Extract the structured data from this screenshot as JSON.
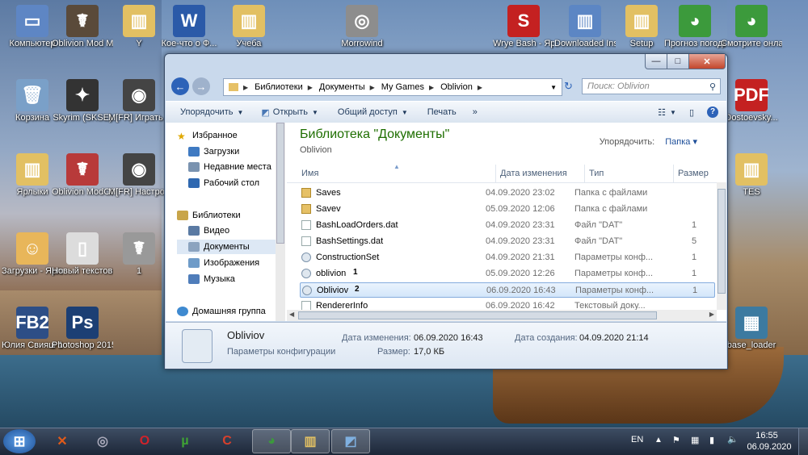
{
  "desktop": {
    "icons_left": [
      {
        "label": "Компьютер",
        "glyph": "▭",
        "color": "#5e86c4"
      },
      {
        "label": "Oblivion Mod M...",
        "glyph": "☤",
        "color": "#5a4a3a"
      },
      {
        "label": "Y",
        "glyph": "▥",
        "color": "#e2c063"
      },
      {
        "label": "Кое-что о Ф...",
        "glyph": "W",
        "color": "#2b5aa8"
      },
      {
        "label": "Учеба",
        "glyph": "▥",
        "color": "#e2c063"
      },
      {
        "label": "Morrowind",
        "glyph": "◎",
        "color": "#8d8d8d"
      },
      {
        "label": "Корзина",
        "glyph": "🗑",
        "color": "#7aa0c8"
      },
      {
        "label": "Skyrim (SKSE)",
        "glyph": "✦",
        "color": "#333"
      },
      {
        "label": "M[FR] Играть (...",
        "glyph": "◉",
        "color": "#444"
      },
      {
        "label": "Ярлыки",
        "glyph": "▥",
        "color": "#e2c063"
      },
      {
        "label": "Oblivion ModCORE",
        "glyph": "☤",
        "color": "#b83a3a"
      },
      {
        "label": "M[FR] Настройщик",
        "glyph": "◉",
        "color": "#444"
      },
      {
        "label": "Загрузки - Ярлык",
        "glyph": "☺",
        "color": "#e8b65a"
      },
      {
        "label": "Новый текстовый...",
        "glyph": "▯",
        "color": "#dcdcdc"
      },
      {
        "label": "1",
        "glyph": "☤",
        "color": "#999"
      },
      {
        "label": "Юлия Свияш 10 Запове...",
        "glyph": "FB2",
        "color": "#2d4e86"
      },
      {
        "label": "Photoshop 2015",
        "glyph": "Ps",
        "color": "#1c3f74"
      }
    ],
    "icons_right": [
      {
        "label": "Wrye Bash - Ярлык",
        "glyph": "S",
        "color": "#c42121"
      },
      {
        "label": "Downloaded Installers",
        "glyph": "▥",
        "color": "#5c86c4"
      },
      {
        "label": "Setup",
        "glyph": "▥",
        "color": "#e2c063"
      },
      {
        "label": "Прогноз погоды",
        "glyph": "◕",
        "color": "#3c9a3c"
      },
      {
        "label": "Смотрите онлайн пр...",
        "glyph": "◕",
        "color": "#3c9a3c"
      },
      {
        "label": "Dostoevsky...",
        "glyph": "PDF",
        "color": "#c42121"
      },
      {
        "label": "TES",
        "glyph": "▥",
        "color": "#e2c063"
      },
      {
        "label": "base_loader",
        "glyph": "▦",
        "color": "#3c7aa0"
      }
    ]
  },
  "window": {
    "controls": {
      "minimize": "—",
      "maximize": "□",
      "close": "✕"
    },
    "address": {
      "crumbs": [
        "Библиотеки",
        "Документы",
        "My Games",
        "Oblivion"
      ],
      "search_placeholder": "Поиск: Oblivion"
    },
    "toolbar": {
      "organize": "Упорядочить",
      "open": "Открыть",
      "share": "Общий доступ",
      "print": "Печать",
      "more": "»"
    },
    "nav": {
      "favorites": "Избранное",
      "downloads": "Загрузки",
      "recent": "Недавние места",
      "desktop": "Рабочий стол",
      "libraries": "Библиотеки",
      "video": "Видео",
      "documents": "Документы",
      "images": "Изображения",
      "music": "Музыка",
      "homegroup": "Домашняя группа"
    },
    "library": {
      "title": "Библиотека \"Документы\"",
      "subtitle": "Oblivion",
      "arrange_label": "Упорядочить:",
      "arrange_value": "Папка"
    },
    "columns": {
      "name": "Имя",
      "date": "Дата изменения",
      "type": "Тип",
      "size": "Размер"
    },
    "files": [
      {
        "name": "Saves",
        "date": "04.09.2020 23:02",
        "type": "Папка с файлами",
        "size": "",
        "kind": "folder",
        "mark": ""
      },
      {
        "name": "Savev",
        "date": "05.09.2020 12:06",
        "type": "Папка с файлами",
        "size": "",
        "kind": "folder",
        "mark": ""
      },
      {
        "name": "BashLoadOrders.dat",
        "date": "04.09.2020 23:31",
        "type": "Файл \"DAT\"",
        "size": "1",
        "kind": "file",
        "mark": ""
      },
      {
        "name": "BashSettings.dat",
        "date": "04.09.2020 23:31",
        "type": "Файл \"DAT\"",
        "size": "5",
        "kind": "file",
        "mark": ""
      },
      {
        "name": "ConstructionSet",
        "date": "04.09.2020 21:31",
        "type": "Параметры конф...",
        "size": "1",
        "kind": "cfg",
        "mark": ""
      },
      {
        "name": "oblivion",
        "date": "05.09.2020 12:26",
        "type": "Параметры конф...",
        "size": "1",
        "kind": "cfg",
        "mark": "1"
      },
      {
        "name": "Obliviov",
        "date": "06.09.2020 16:43",
        "type": "Параметры конф...",
        "size": "1",
        "kind": "cfg",
        "mark": "2"
      },
      {
        "name": "RendererInfo",
        "date": "06.09.2020 16:42",
        "type": "Текстовый доку...",
        "size": "",
        "kind": "file",
        "mark": ""
      }
    ],
    "details": {
      "name": "Obliviov",
      "type": "Параметры конфигурации",
      "modified_label": "Дата изменения:",
      "modified_value": "06.09.2020 16:43",
      "created_label": "Дата создания:",
      "created_value": "04.09.2020 21:14",
      "size_label": "Размер:",
      "size_value": "17,0 КБ"
    }
  },
  "taskbar": {
    "start_glyph": "⊞",
    "apps": [
      {
        "name": "taskbar-app-1",
        "glyph": "✕",
        "color": "#e05a1a"
      },
      {
        "name": "taskbar-app-disc",
        "glyph": "◎",
        "color": "#aab"
      },
      {
        "name": "taskbar-app-opera",
        "glyph": "O",
        "color": "#d0222a"
      },
      {
        "name": "taskbar-app-utorrent",
        "glyph": "µ",
        "color": "#3fa434"
      },
      {
        "name": "taskbar-app-ccleaner",
        "glyph": "C",
        "color": "#d8402c"
      },
      {
        "name": "taskbar-app-chrome",
        "glyph": "◕",
        "color": "#3c9a3c"
      },
      {
        "name": "taskbar-app-explorer",
        "glyph": "▥",
        "color": "#e2c063"
      },
      {
        "name": "taskbar-app-window",
        "glyph": "◩",
        "color": "#7fb0e0"
      }
    ],
    "lang": "EN",
    "time": "16:55",
    "date": "06.09.2020"
  }
}
